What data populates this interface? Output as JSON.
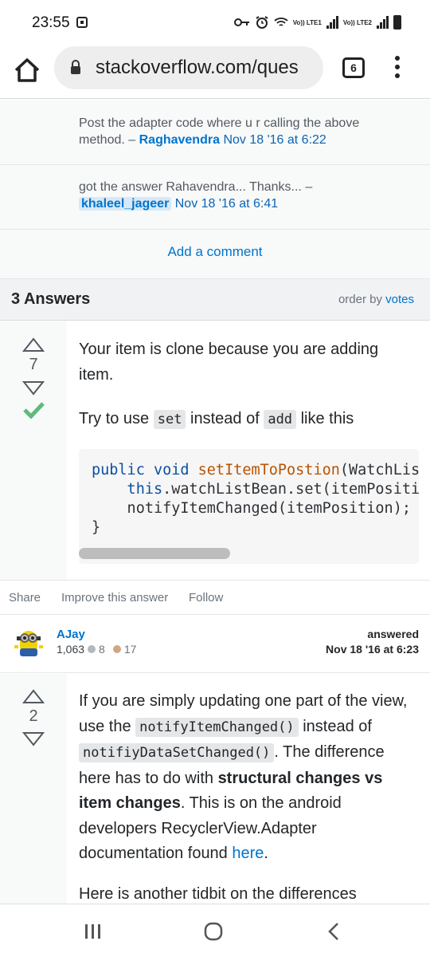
{
  "status_bar": {
    "time": "23:55",
    "lte1_label": "Vo)) LTE1",
    "lte2_label": "Vo)) LTE2"
  },
  "browser": {
    "url": "stackoverflow.com/ques",
    "tab_count": "6"
  },
  "comments": [
    {
      "text": "Post the adapter code where u r calling the above method. – ",
      "user": "Raghavendra",
      "date": "Nov 18 '16 at 6:22"
    },
    {
      "text": "got the answer Rahavendra... Thanks... – ",
      "user": "khaleel_jageer",
      "date": "Nov 18 '16 at 6:41"
    }
  ],
  "add_comment_label": "Add a comment",
  "answers_header": {
    "count_label": "3 Answers",
    "order_prefix": "order by",
    "order_value": "votes"
  },
  "answer1": {
    "votes": "7",
    "para1": "Your item is clone because you are adding item.",
    "para2_before": "Try to use",
    "code_set": "set",
    "para2_mid": "instead of",
    "code_add": "add",
    "para2_after": "like this",
    "code_lines": [
      {
        "kw": "public void ",
        "fn": "setItemToPostion",
        "rest": "(WatchList"
      },
      {
        "kw": "    this",
        "fn": "",
        "rest": ".watchListBean.set(itemPositio"
      },
      {
        "kw": "",
        "fn": "",
        "rest": "    notifyItemChanged(itemPosition);"
      },
      {
        "kw": "",
        "fn": "",
        "rest": "}"
      }
    ],
    "share": "Share",
    "improve": "Improve this answer",
    "follow": "Follow",
    "user_name": "AJay",
    "user_rep": "1,063",
    "silver_badges": "8",
    "bronze_badges": "17",
    "answered_label": "answered",
    "answered_date": "Nov 18 '16 at 6:23"
  },
  "answer2": {
    "votes": "2",
    "t1": "If you are simply updating one part of the view, use the",
    "code1": "notifyItemChanged()",
    "t2": "instead of",
    "code2": "notifiyDataSetChanged()",
    "t3": ". The difference here has to do with",
    "bold": "structural changes vs item changes",
    "t4": ". This is on the android developers RecyclerView.Adapter documentation found",
    "link": "here",
    "t5": ".",
    "para2": "Here is another tidbit on the differences"
  },
  "colors": {
    "link": "#0074cc",
    "accepted": "#5eba7d",
    "bronze": "#d1a684",
    "silver": "#b4b8bc"
  }
}
